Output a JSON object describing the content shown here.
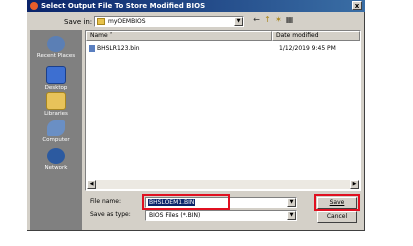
{
  "window": {
    "title": "Select Output File To Store Modified BIOS",
    "close_label": "x"
  },
  "save_in": {
    "label": "Save in:",
    "value": "myOEMBIOS"
  },
  "toolbar": {
    "back_icon": "←",
    "up_icon": "↑",
    "new_folder_icon": "✶",
    "views_icon": "▦"
  },
  "places": [
    {
      "label": "Recent Places",
      "color": "#5b7fb5"
    },
    {
      "label": "Desktop",
      "color": "#3d6fd1"
    },
    {
      "label": "Libraries",
      "color": "#e8c35a"
    },
    {
      "label": "Computer",
      "color": "#6a8fc4"
    },
    {
      "label": "Network",
      "color": "#2c5aa0"
    }
  ],
  "file_list": {
    "columns": [
      "Name",
      "Date modified"
    ],
    "rows": [
      {
        "name": "BHSLR123.bin",
        "date": "1/12/2019 9:45 PM"
      }
    ]
  },
  "file_name": {
    "label": "File name:",
    "value": "BHSLOEM1.BIN"
  },
  "save_as_type": {
    "label": "Save as type:",
    "value": "BIOS Files (*.BIN)"
  },
  "buttons": {
    "save": "Save",
    "cancel": "Cancel"
  },
  "accent": "#e01020"
}
